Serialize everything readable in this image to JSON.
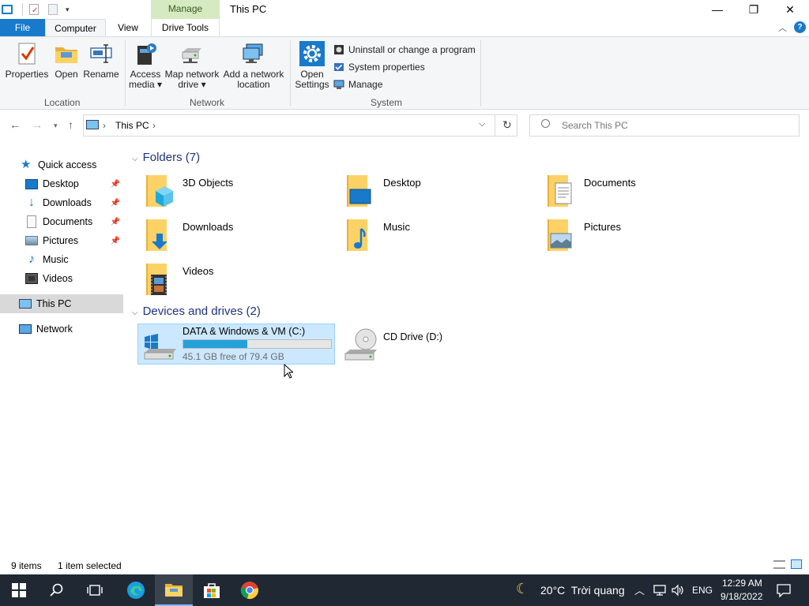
{
  "window": {
    "title": "This PC",
    "contextual_tab": "Manage",
    "min_glyph": "—",
    "max_glyph": "❐",
    "close_glyph": "✕"
  },
  "tabs": {
    "file": "File",
    "computer": "Computer",
    "view": "View",
    "drive_tools": "Drive Tools"
  },
  "ribbon": {
    "location": {
      "label": "Location",
      "properties": "Properties",
      "open": "Open",
      "rename": "Rename"
    },
    "network": {
      "label": "Network",
      "access_media_1": "Access",
      "access_media_2": "media ▾",
      "map_drive_1": "Map network",
      "map_drive_2": "drive ▾",
      "add_location_1": "Add a network",
      "add_location_2": "location"
    },
    "system": {
      "label": "System",
      "open_settings_1": "Open",
      "open_settings_2": "Settings",
      "uninstall": "Uninstall or change a program",
      "system_properties": "System properties",
      "manage": "Manage"
    }
  },
  "address": {
    "path_item": "This PC",
    "sep": "›",
    "search_placeholder": "Search This PC"
  },
  "sidebar": {
    "items": [
      {
        "label": "Quick access",
        "icon": "star-icon"
      },
      {
        "label": "Desktop",
        "icon": "desktop-icon",
        "pinned": true
      },
      {
        "label": "Downloads",
        "icon": "download-icon",
        "pinned": true
      },
      {
        "label": "Documents",
        "icon": "document-icon",
        "pinned": true
      },
      {
        "label": "Pictures",
        "icon": "picture-icon",
        "pinned": true
      },
      {
        "label": "Music",
        "icon": "music-icon"
      },
      {
        "label": "Videos",
        "icon": "video-icon"
      },
      {
        "label": "This PC",
        "icon": "computer-icon",
        "selected": true
      },
      {
        "label": "Network",
        "icon": "network-icon"
      }
    ]
  },
  "content": {
    "folders_header": "Folders (7)",
    "folders": [
      {
        "name": "3D Objects"
      },
      {
        "name": "Desktop"
      },
      {
        "name": "Documents"
      },
      {
        "name": "Downloads"
      },
      {
        "name": "Music"
      },
      {
        "name": "Pictures"
      },
      {
        "name": "Videos"
      }
    ],
    "drives_header": "Devices and drives (2)",
    "drives": [
      {
        "name": "DATA & Windows & VM (C:)",
        "free_text": "45.1 GB free of 79.4 GB",
        "used_fraction": 0.432,
        "selected": true
      },
      {
        "name": "CD Drive (D:)"
      }
    ]
  },
  "status": {
    "items": "9 items",
    "selected": "1 item selected"
  },
  "taskbar": {
    "weather": "20°C  Trời quang",
    "language": "ENG",
    "time": "12:29 AM",
    "date": "9/18/2022"
  },
  "colors": {
    "accent": "#1979ca",
    "selection": "#cce8ff",
    "selection_border": "#99d1ff",
    "progress": "#26a0da",
    "taskbar": "#202833",
    "heading": "#1e3287"
  }
}
